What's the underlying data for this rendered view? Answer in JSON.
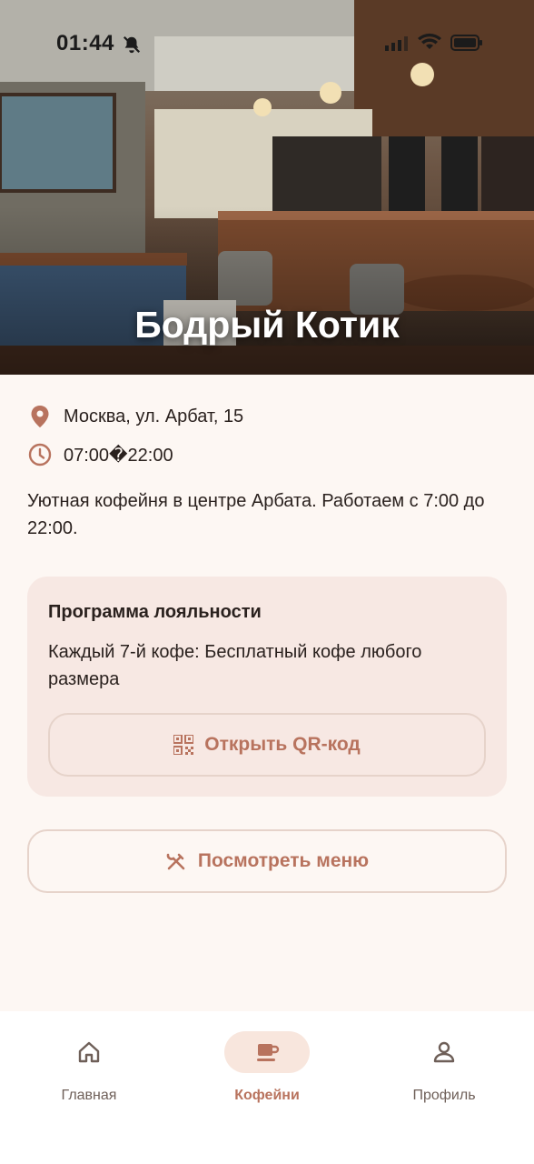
{
  "status_bar": {
    "time": "01:44"
  },
  "cafe": {
    "name": "Бодрый Котик",
    "address": "Москва, ул. Арбат, 15",
    "hours": "07:00�22:00",
    "description": "Уютная кофейня в центре Арбата. Работаем с 7:00 до 22:00."
  },
  "loyalty": {
    "title": "Программа лояльности",
    "text": "Каждый 7-й кофе: Бесплатный кофе любого размера",
    "qr_button": "Открыть QR-код"
  },
  "menu_button": "Посмотреть меню",
  "nav": {
    "home": "Главная",
    "cafes": "Кофейни",
    "profile": "Профиль"
  },
  "colors": {
    "accent": "#b8735e",
    "background": "#fdf7f3",
    "card": "#f7e8e3"
  },
  "icons": [
    "location-pin-icon",
    "clock-icon",
    "qr-code-icon",
    "utensils-icon",
    "home-icon",
    "coffee-cup-icon",
    "person-icon",
    "bell-off-icon",
    "signal-icon",
    "wifi-icon",
    "battery-icon"
  ]
}
